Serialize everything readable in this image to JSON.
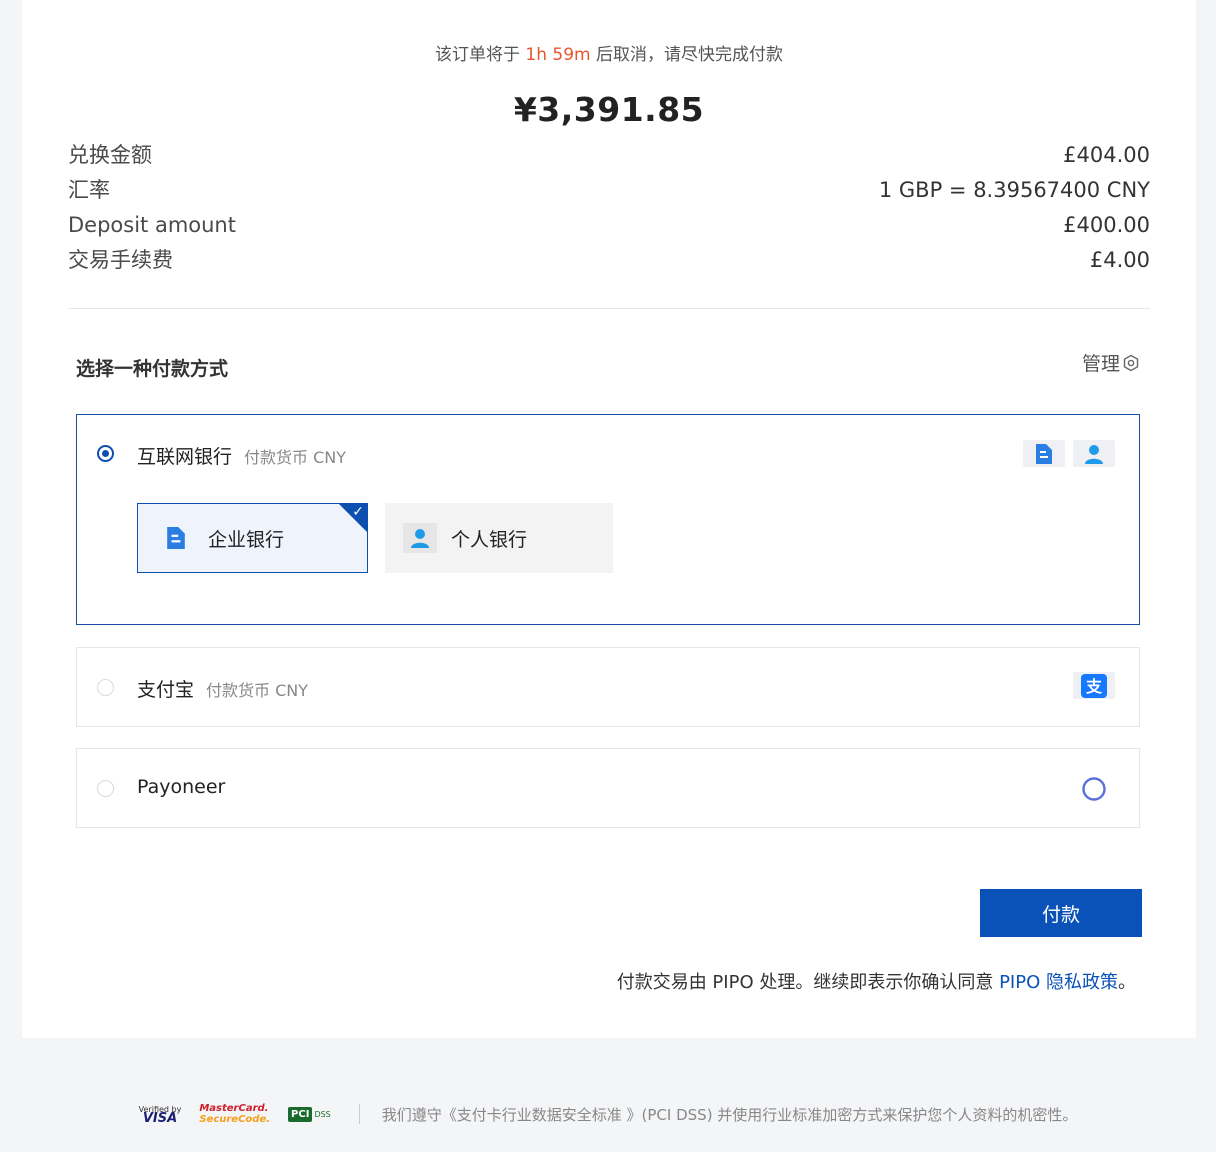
{
  "countdown": {
    "prefix": "该订单将于",
    "time": "1h 59m",
    "suffix": "后取消，请尽快完成付款"
  },
  "total_amount": "¥3,391.85",
  "summary": [
    {
      "label": "兑换金额",
      "value": "£404.00"
    },
    {
      "label": "汇率",
      "value": "1 GBP = 8.39567400 CNY"
    },
    {
      "label": "Deposit amount",
      "value": "£400.00"
    },
    {
      "label": "交易手续费",
      "value": "£4.00"
    }
  ],
  "payment_section": {
    "title": "选择一种付款方式",
    "manage_label": "管理"
  },
  "methods": [
    {
      "name": "互联网银行",
      "currency": "付款货币 CNY",
      "selected": true,
      "icons": [
        "enterprise-bank-icon",
        "personal-bank-icon"
      ]
    },
    {
      "name": "支付宝",
      "currency": "付款货币 CNY",
      "selected": false,
      "icons": [
        "alipay-icon"
      ]
    },
    {
      "name": "Payoneer",
      "currency": "",
      "selected": false,
      "icons": [
        "payoneer-icon"
      ]
    }
  ],
  "bank_options": {
    "enterprise": "企业银行",
    "personal": "个人银行"
  },
  "pay_button": "付款",
  "terms": {
    "text": "付款交易由 PIPO 处理。继续即表示你确认同意",
    "link": "PIPO 隐私政策",
    "end": "。"
  },
  "footer": {
    "badges": {
      "visa_top": "Verified by",
      "visa_main": "VISA",
      "mc_top": "MasterCard.",
      "mc_bottom": "SecureCode.",
      "pci_main": "PCI",
      "pci_sub": "DSS"
    },
    "text": "我们遵守《支付卡行业数据安全标准 》(PCI DSS) 并使用行业标准加密方式来保护您个人资料的机密性。"
  },
  "colors": {
    "accent": "#0a52b8",
    "countdown": "#e8542e",
    "selected_border": "#1a4fa8"
  }
}
